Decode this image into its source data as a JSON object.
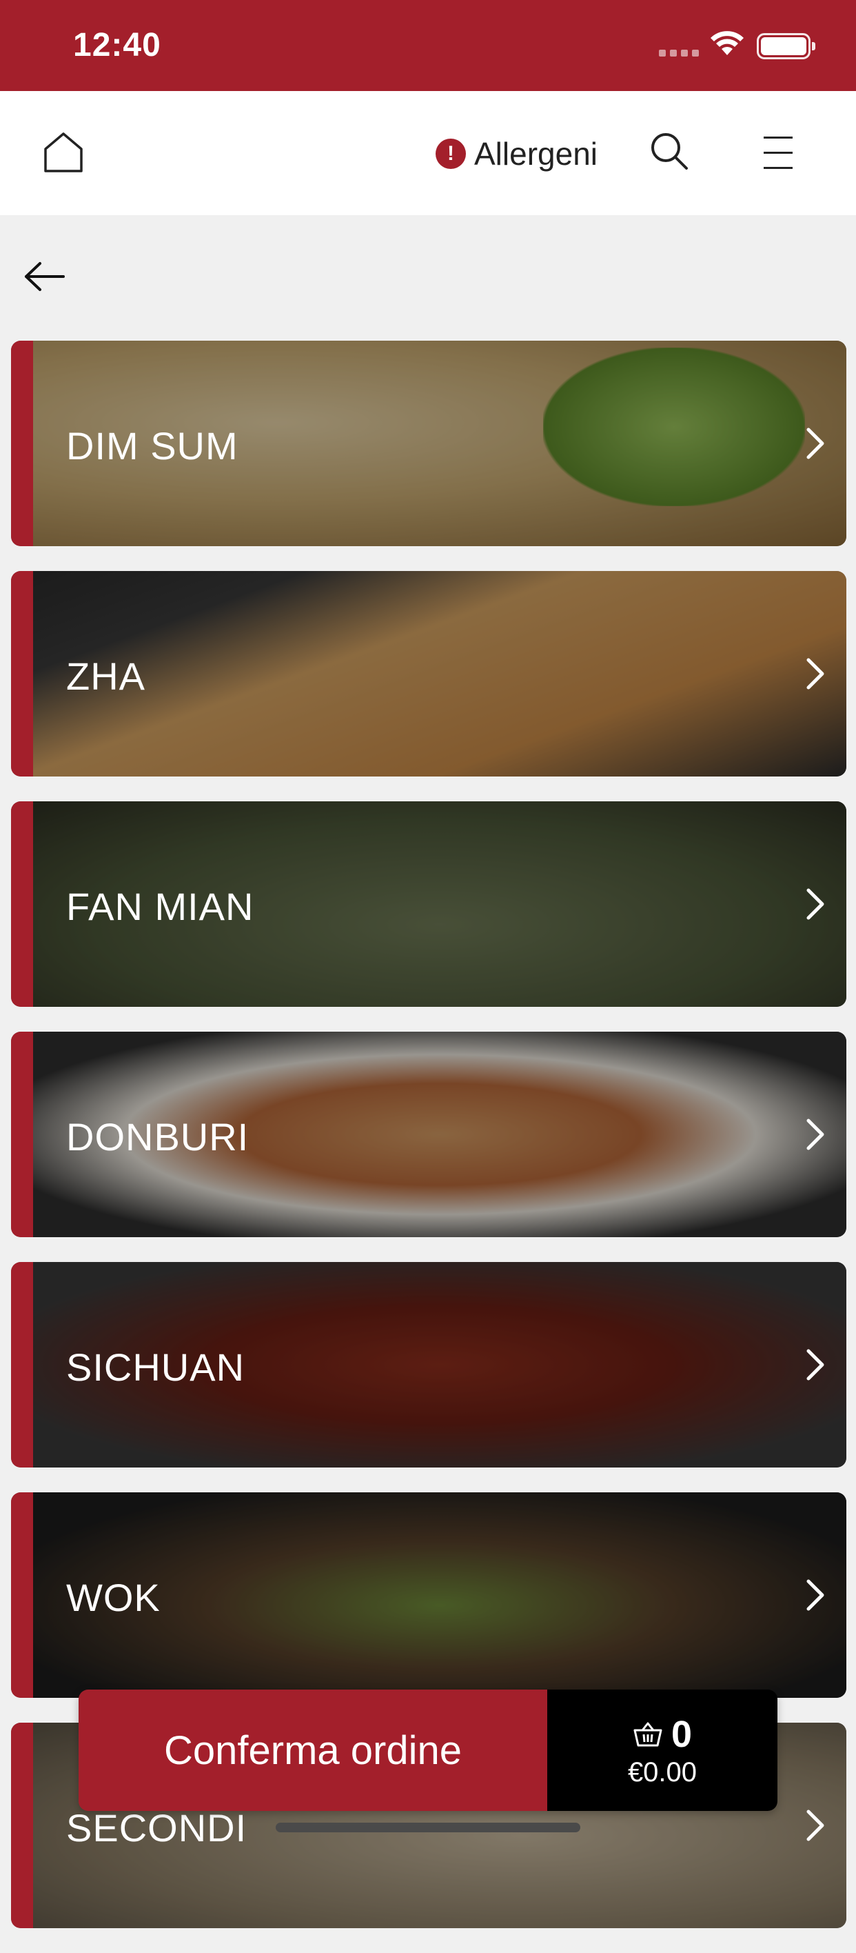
{
  "status": {
    "time": "12:40"
  },
  "header": {
    "allergen_label": "Allergeni",
    "accent_color": "#a31f2b"
  },
  "categories": [
    {
      "label": "DIM SUM"
    },
    {
      "label": "ZHA"
    },
    {
      "label": "FAN MIAN"
    },
    {
      "label": "DONBURI"
    },
    {
      "label": "SICHUAN"
    },
    {
      "label": "WOK"
    },
    {
      "label": "SECONDI"
    }
  ],
  "footer": {
    "confirm_label": "Conferma ordine",
    "cart_count": "0",
    "cart_total": "€0.00"
  }
}
